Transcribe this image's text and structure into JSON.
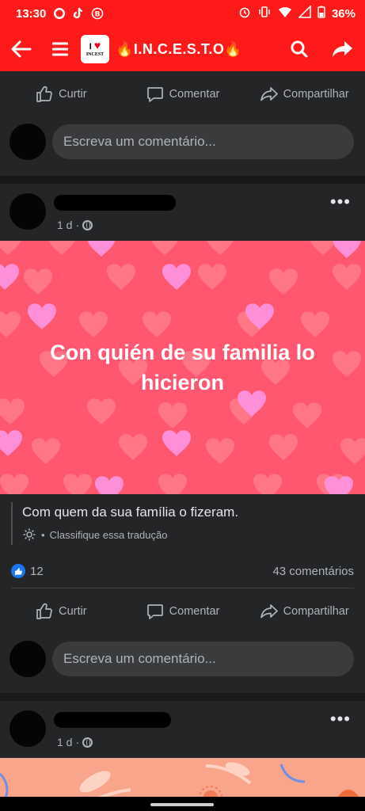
{
  "status_bar": {
    "time": "13:30",
    "battery": "36%",
    "icons_left": [
      "whatsapp-icon",
      "tiktok-icon",
      "bitcoin-icon"
    ],
    "icons_right": [
      "alarm-icon",
      "vibrate-icon",
      "wifi-icon",
      "signal-icon",
      "battery-icon"
    ]
  },
  "app_bar": {
    "title": "🔥I.N.C.E.S.T.O🔥",
    "logo_text_top": "I",
    "logo_text_bottom": "INCEST"
  },
  "actions": {
    "like": "Curtir",
    "comment": "Comentar",
    "share": "Compartilhar"
  },
  "comment_box": {
    "placeholder": "Escreva um comentário..."
  },
  "post": {
    "time": "1 d",
    "separator": "·",
    "image_text": "Con quién de su familia lo hicieron",
    "translation": "Com quem da sua família o fizeram.",
    "rate_translation": "Classifique essa tradução",
    "likes": "12",
    "comments": "43 comentários"
  },
  "next_post": {
    "time": "1 d",
    "separator": "·"
  },
  "colors": {
    "brand_red": "#ff1a1a",
    "background": "#18191a",
    "card": "#242526",
    "like_blue": "#1877f2"
  }
}
